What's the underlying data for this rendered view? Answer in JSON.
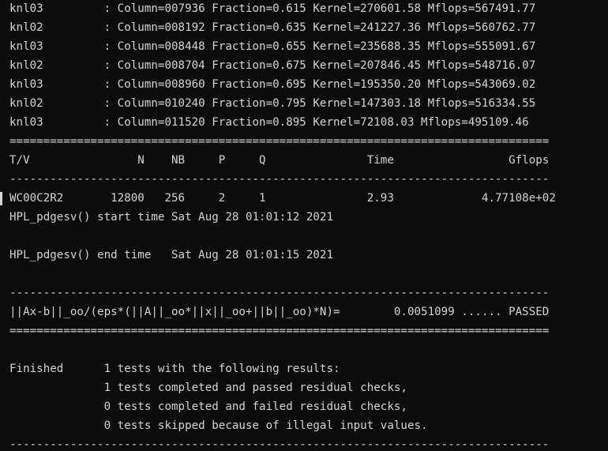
{
  "terminal": {
    "lines": [
      "knl03         : Column=007936 Fraction=0.615 Kernel=270601.58 Mflops=567491.77",
      "knl02         : Column=008192 Fraction=0.635 Kernel=241227.36 Mflops=560762.77",
      "knl03         : Column=008448 Fraction=0.655 Kernel=235688.35 Mflops=555091.67",
      "knl02         : Column=008704 Fraction=0.675 Kernel=207846.45 Mflops=548716.07",
      "knl03         : Column=008960 Fraction=0.695 Kernel=195350.20 Mflops=543069.02",
      "knl02         : Column=010240 Fraction=0.795 Kernel=147303.18 Mflops=516334.55",
      "knl03         : Column=011520 Fraction=0.895 Kernel=72108.03 Mflops=495109.46",
      "================================================================================",
      "T/V                N    NB     P     Q               Time                 Gflops",
      "--------------------------------------------------------------------------------",
      "WC00C2R2       12800   256     2     1               2.93             4.77108e+02",
      "HPL_pdgesv() start time Sat Aug 28 01:01:12 2021",
      "",
      "HPL_pdgesv() end time   Sat Aug 28 01:01:15 2021",
      "",
      "--------------------------------------------------------------------------------",
      "||Ax-b||_oo/(eps*(||A||_oo*||x||_oo+||b||_oo)*N)=        0.0051099 ...... PASSED",
      "================================================================================",
      "",
      "Finished      1 tests with the following results:",
      "              1 tests completed and passed residual checks,",
      "              0 tests completed and failed residual checks,",
      "              0 tests skipped because of illegal input values.",
      "--------------------------------------------------------------------------------"
    ]
  },
  "colors": {
    "background": "#0c0c0c",
    "foreground": "#d4d4d4"
  }
}
